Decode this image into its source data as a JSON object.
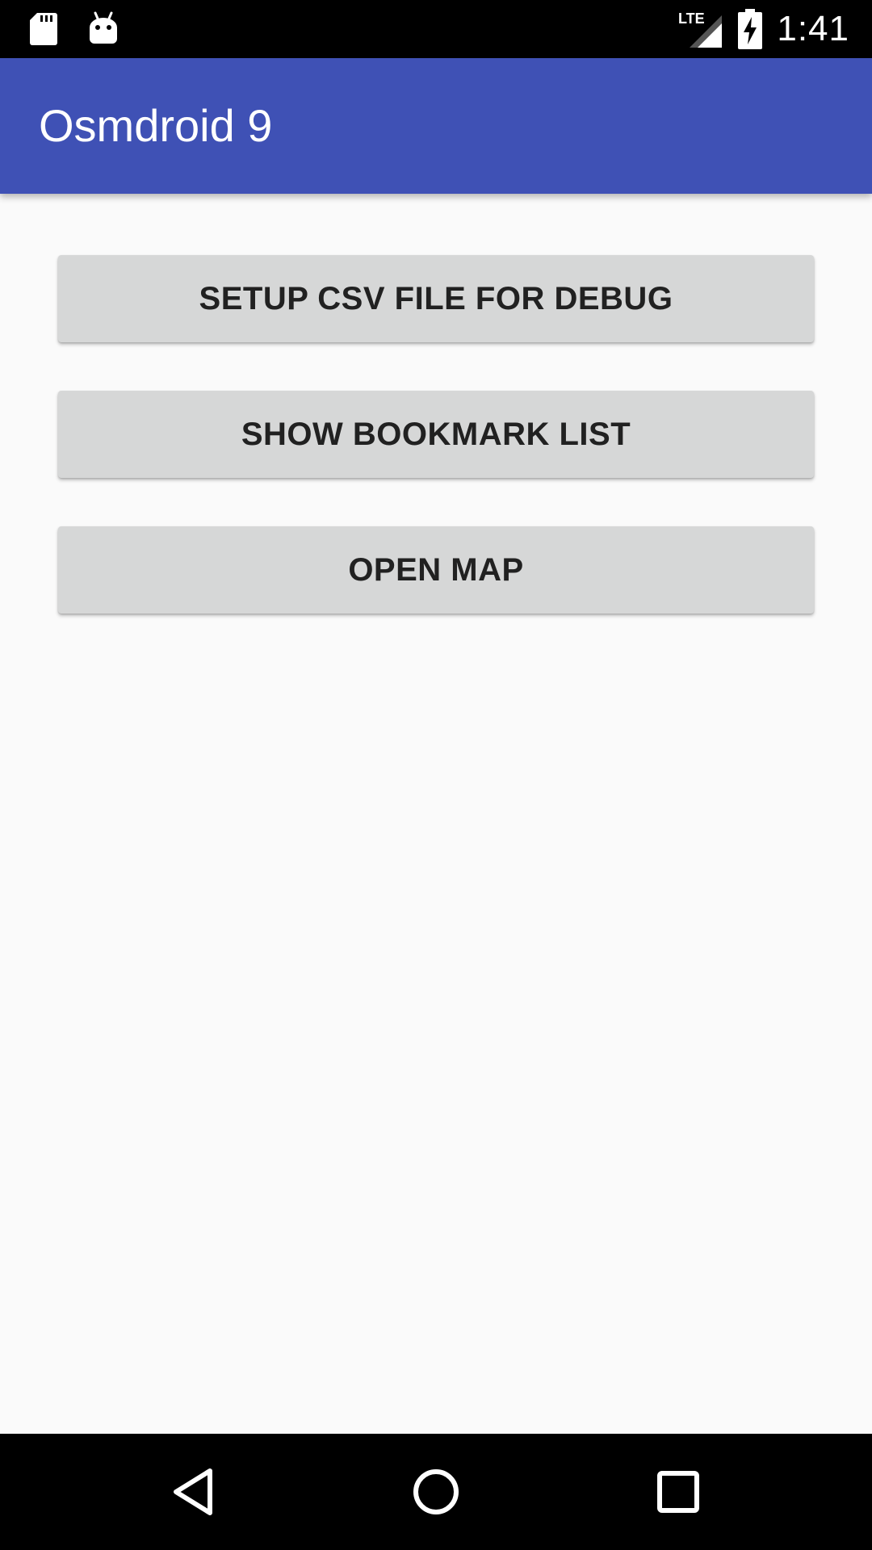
{
  "status_bar": {
    "time": "1:41",
    "network": "LTE",
    "left_icons": [
      "sd-card-icon",
      "android-debug-icon"
    ],
    "right_icons": [
      "lte-signal-icon",
      "battery-charging-icon"
    ]
  },
  "app_bar": {
    "title": "Osmdroid 9",
    "color": "#3f51b5"
  },
  "buttons": {
    "setup_csv": "SETUP CSV FILE FOR DEBUG",
    "show_bookmarks": "SHOW BOOKMARK LIST",
    "open_map": "OPEN MAP"
  },
  "nav_bar": {
    "icons": [
      "back-icon",
      "home-icon",
      "recents-icon"
    ]
  }
}
